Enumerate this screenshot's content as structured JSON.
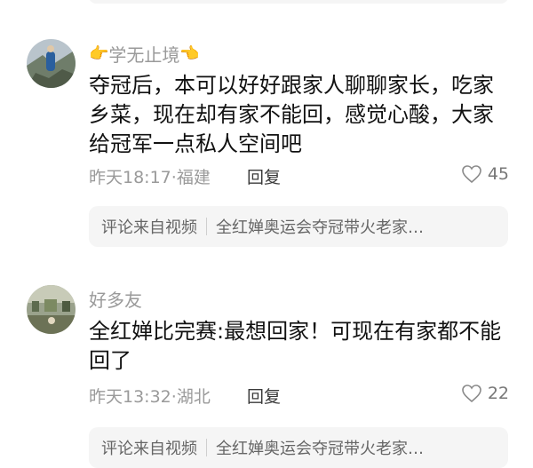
{
  "comments": [
    {
      "username": "学无止境",
      "username_icon": "pointing-hand-icon",
      "text": "夺冠后，本可以好好跟家人聊聊家长，吃家乡菜，现在却有家不能回，感觉心酸，大家给冠军一点私人空间吧",
      "time": "昨天18:17",
      "location": "福建",
      "reply_label": "回复",
      "likes": "45",
      "source_label": "评论来自视频",
      "source_title": "全红婵奥运会夺冠带火老家…"
    },
    {
      "username": "好多友",
      "text": "全红婵比完赛:最想回家！可现在有家都不能回了",
      "time": "昨天13:32",
      "location": "湖北",
      "reply_label": "回复",
      "likes": "22",
      "source_label": "评论来自视频",
      "source_title": "全红婵奥运会夺冠带火老家…"
    }
  ],
  "meta_separator": "·",
  "colors": {
    "meta": "#9a9a9a",
    "card_bg": "#f5f5f5",
    "text": "#111111"
  }
}
